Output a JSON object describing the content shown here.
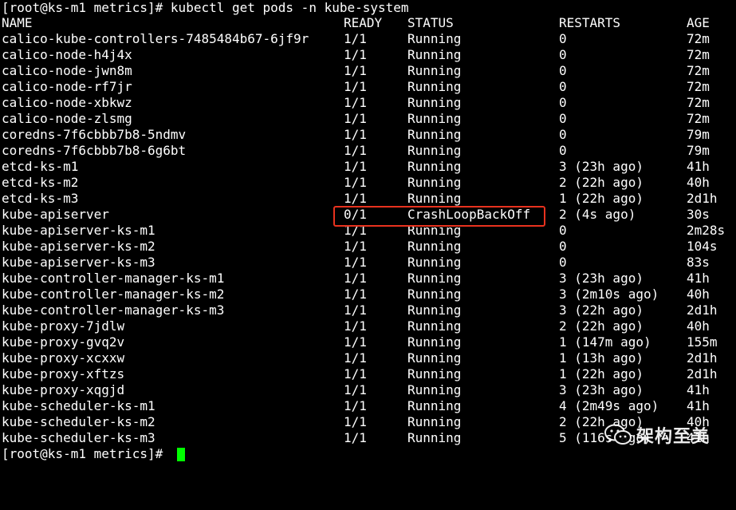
{
  "colors": {
    "background": "#000000",
    "text": "#ffffff",
    "cursor": "#00ff00",
    "highlight_border": "#e8321e"
  },
  "command_line": "[root@ks-m1 metrics]# kubectl get pods -n kube-system",
  "header": {
    "name": "NAME",
    "ready": "READY",
    "status": "STATUS",
    "restarts": "RESTARTS",
    "age": "AGE"
  },
  "rows": [
    {
      "name": "calico-kube-controllers-7485484b67-6jf9r",
      "ready": "1/1",
      "status": "Running",
      "restarts": "0",
      "age": "72m"
    },
    {
      "name": "calico-node-h4j4x",
      "ready": "1/1",
      "status": "Running",
      "restarts": "0",
      "age": "72m"
    },
    {
      "name": "calico-node-jwn8m",
      "ready": "1/1",
      "status": "Running",
      "restarts": "0",
      "age": "72m"
    },
    {
      "name": "calico-node-rf7jr",
      "ready": "1/1",
      "status": "Running",
      "restarts": "0",
      "age": "72m"
    },
    {
      "name": "calico-node-xbkwz",
      "ready": "1/1",
      "status": "Running",
      "restarts": "0",
      "age": "72m"
    },
    {
      "name": "calico-node-zlsmg",
      "ready": "1/1",
      "status": "Running",
      "restarts": "0",
      "age": "72m"
    },
    {
      "name": "coredns-7f6cbbb7b8-5ndmv",
      "ready": "1/1",
      "status": "Running",
      "restarts": "0",
      "age": "79m"
    },
    {
      "name": "coredns-7f6cbbb7b8-6g6bt",
      "ready": "1/1",
      "status": "Running",
      "restarts": "0",
      "age": "79m"
    },
    {
      "name": "etcd-ks-m1",
      "ready": "1/1",
      "status": "Running",
      "restarts": "3 (23h ago)",
      "age": "41h"
    },
    {
      "name": "etcd-ks-m2",
      "ready": "1/1",
      "status": "Running",
      "restarts": "2 (22h ago)",
      "age": "40h"
    },
    {
      "name": "etcd-ks-m3",
      "ready": "1/1",
      "status": "Running",
      "restarts": "1 (22h ago)",
      "age": "2d1h"
    },
    {
      "name": "kube-apiserver",
      "ready": "0/1",
      "status": "CrashLoopBackOff",
      "restarts": "2 (4s ago)",
      "age": "30s"
    },
    {
      "name": "kube-apiserver-ks-m1",
      "ready": "1/1",
      "status": "Running",
      "restarts": "0",
      "age": "2m28s"
    },
    {
      "name": "kube-apiserver-ks-m2",
      "ready": "1/1",
      "status": "Running",
      "restarts": "0",
      "age": "104s"
    },
    {
      "name": "kube-apiserver-ks-m3",
      "ready": "1/1",
      "status": "Running",
      "restarts": "0",
      "age": "83s"
    },
    {
      "name": "kube-controller-manager-ks-m1",
      "ready": "1/1",
      "status": "Running",
      "restarts": "3 (23h ago)",
      "age": "41h"
    },
    {
      "name": "kube-controller-manager-ks-m2",
      "ready": "1/1",
      "status": "Running",
      "restarts": "3 (2m10s ago)",
      "age": "40h"
    },
    {
      "name": "kube-controller-manager-ks-m3",
      "ready": "1/1",
      "status": "Running",
      "restarts": "3 (22h ago)",
      "age": "2d1h"
    },
    {
      "name": "kube-proxy-7jdlw",
      "ready": "1/1",
      "status": "Running",
      "restarts": "2 (22h ago)",
      "age": "40h"
    },
    {
      "name": "kube-proxy-gvq2v",
      "ready": "1/1",
      "status": "Running",
      "restarts": "1 (147m ago)",
      "age": "155m"
    },
    {
      "name": "kube-proxy-xcxxw",
      "ready": "1/1",
      "status": "Running",
      "restarts": "1 (13h ago)",
      "age": "2d1h"
    },
    {
      "name": "kube-proxy-xftzs",
      "ready": "1/1",
      "status": "Running",
      "restarts": "1 (22h ago)",
      "age": "2d1h"
    },
    {
      "name": "kube-proxy-xqgjd",
      "ready": "1/1",
      "status": "Running",
      "restarts": "3 (23h ago)",
      "age": "41h"
    },
    {
      "name": "kube-scheduler-ks-m1",
      "ready": "1/1",
      "status": "Running",
      "restarts": "4 (2m49s ago)",
      "age": "41h"
    },
    {
      "name": "kube-scheduler-ks-m2",
      "ready": "1/1",
      "status": "Running",
      "restarts": "2 (22h ago)",
      "age": "40h"
    },
    {
      "name": "kube-scheduler-ks-m3",
      "ready": "1/1",
      "status": "Running",
      "restarts": "5 (116s ago)",
      "age": "41h"
    }
  ],
  "prompt": "[root@ks-m1 metrics]#",
  "watermark": {
    "icon": "wechat-icon",
    "text": "架构至美"
  }
}
